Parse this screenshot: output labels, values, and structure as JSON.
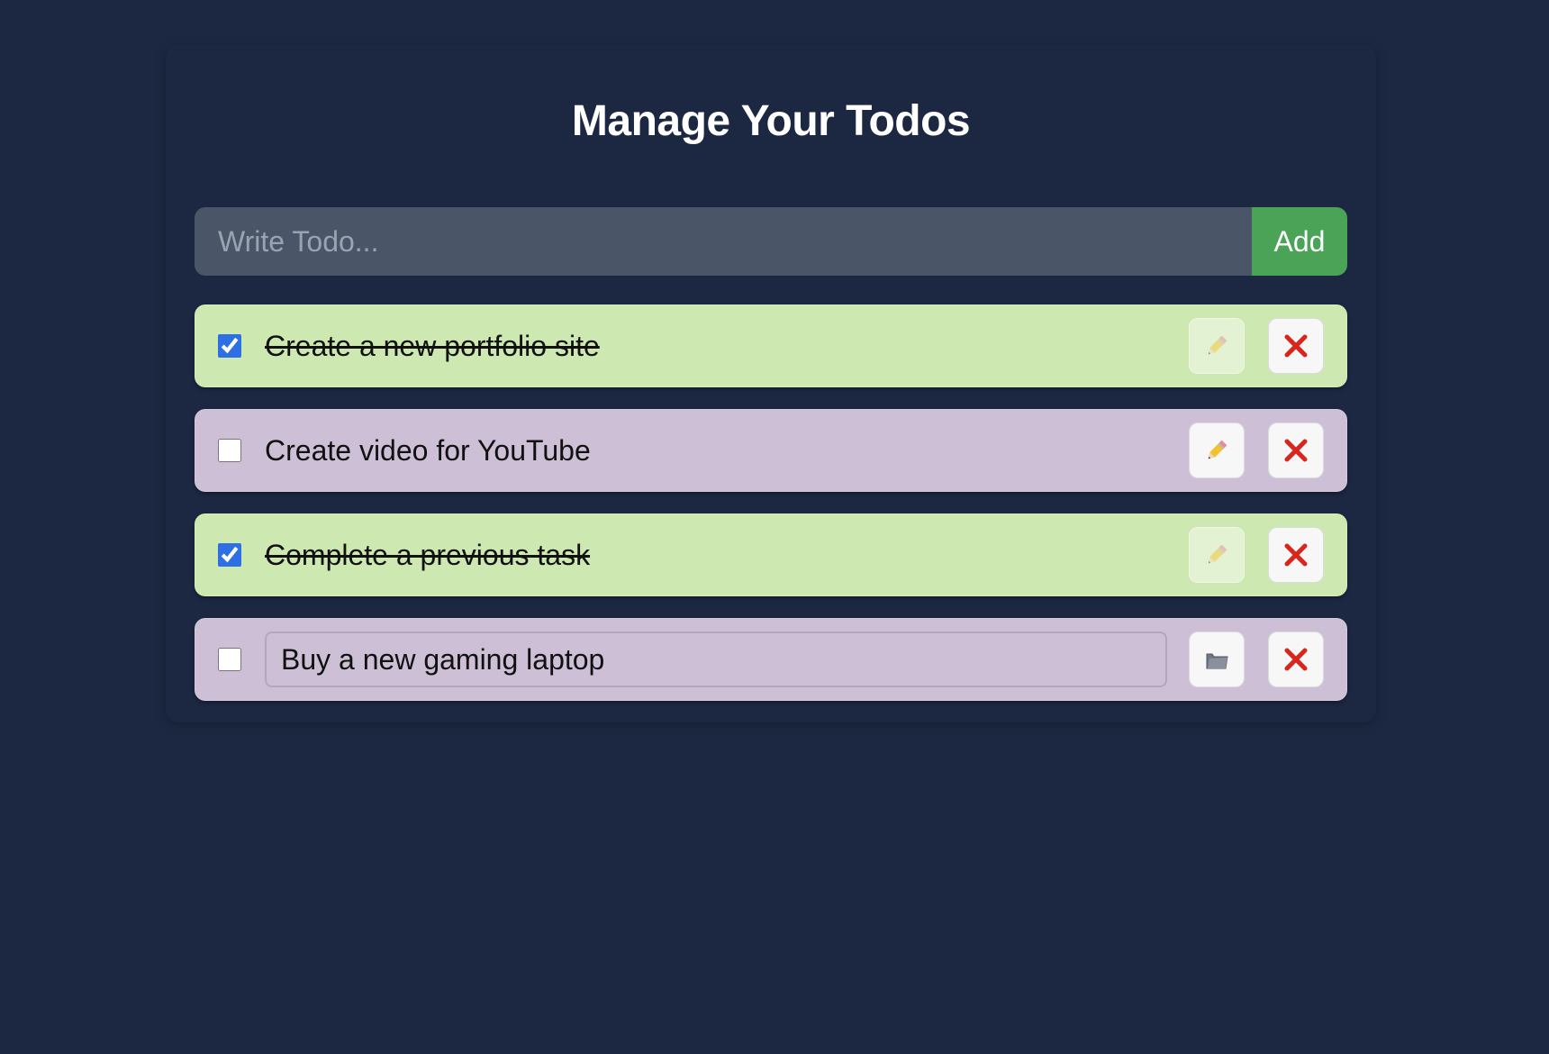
{
  "page": {
    "title": "Manage Your Todos"
  },
  "form": {
    "input_value": "",
    "input_placeholder": "Write Todo...",
    "add_label": "Add"
  },
  "todos": [
    {
      "text": "Create a new portfolio site",
      "completed": true,
      "editing": false,
      "edit_icon": "pencil-icon",
      "delete_icon": "close-icon"
    },
    {
      "text": "Create video for YouTube",
      "completed": false,
      "editing": false,
      "edit_icon": "pencil-icon",
      "delete_icon": "close-icon"
    },
    {
      "text": "Complete a previous task",
      "completed": true,
      "editing": false,
      "edit_icon": "pencil-icon",
      "delete_icon": "close-icon"
    },
    {
      "text": "Buy a new gaming laptop",
      "completed": false,
      "editing": true,
      "edit_icon": "save-icon",
      "delete_icon": "close-icon"
    }
  ],
  "colors": {
    "background": "#1c2842",
    "input_background": "#4a5568",
    "add_button": "#4aa356",
    "completed_item": "#cde8b0",
    "open_item": "#ccbfd6",
    "delete_x": "#d9261c",
    "checkbox_accent": "#2f6fe4"
  }
}
